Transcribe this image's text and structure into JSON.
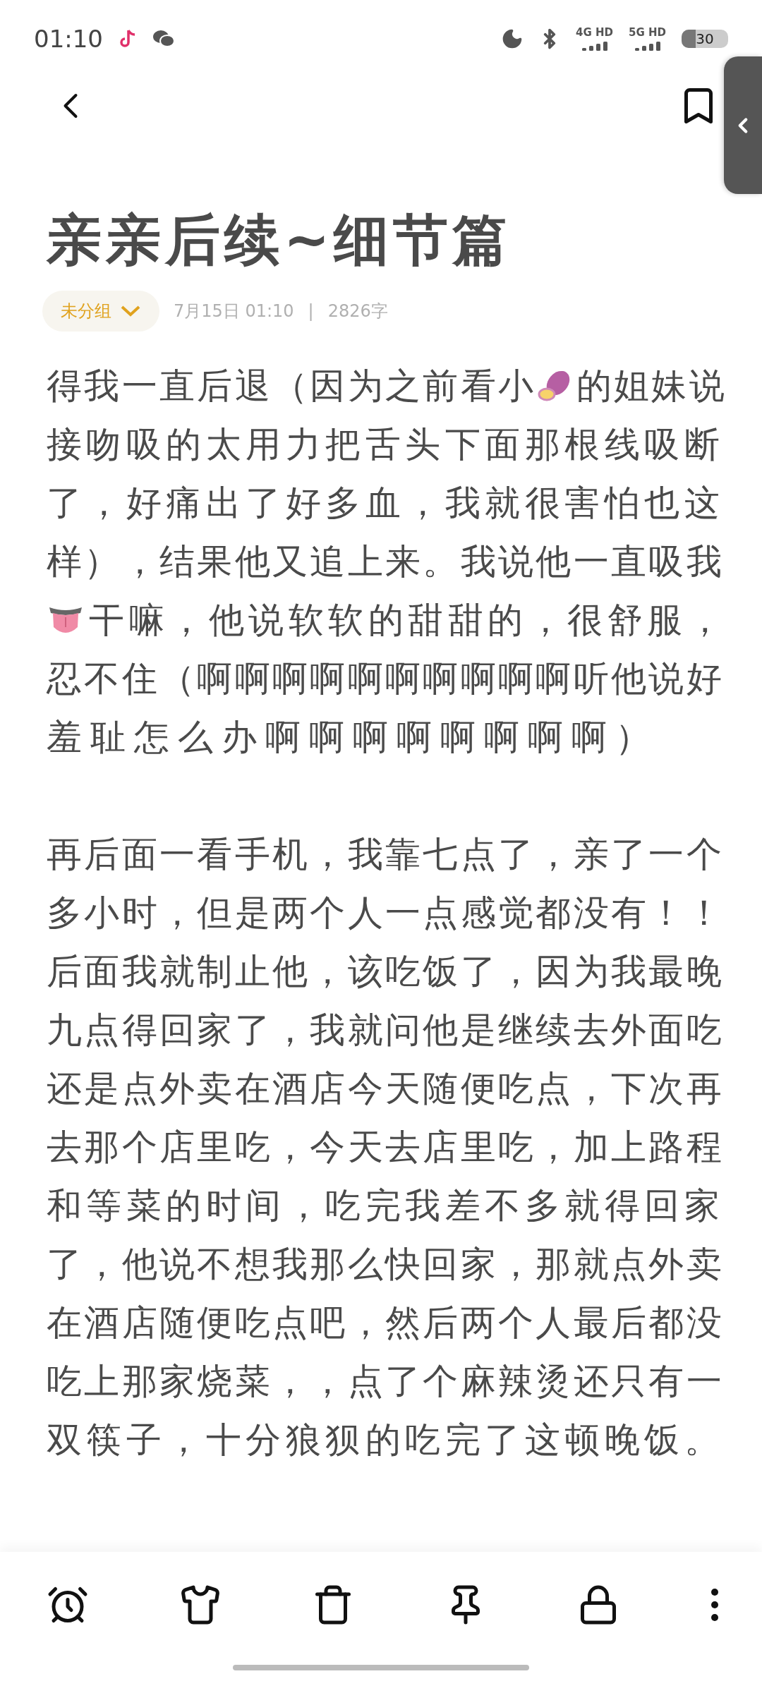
{
  "status_bar": {
    "time": "01:10",
    "network_1": "4G HD",
    "network_2": "5G HD",
    "battery": "30"
  },
  "note": {
    "title": "亲亲后续~细节篇",
    "group": "未分组",
    "date": "7月15日 01:10",
    "separator": "|",
    "word_count": "2826字",
    "paragraphs": [
      {
        "lines": [
          [
            {
              "kind": "text",
              "text": "得我一直后退（因为之前看小"
            },
            {
              "kind": "potato"
            },
            {
              "kind": "text",
              "text": "的姐妹说"
            }
          ],
          [
            {
              "kind": "text",
              "text": "接吻吸的太用力把舌头下面那根线吸断"
            }
          ],
          [
            {
              "kind": "text",
              "text": "了，好痛出了好多血，我就很害怕也这"
            }
          ],
          [
            {
              "kind": "text",
              "text": "样），结果他又追上来。我说他一直吸我"
            }
          ],
          [
            {
              "kind": "tongue"
            },
            {
              "kind": "text",
              "text": "干嘛，他说软软的甜甜的，很舒服，"
            }
          ],
          [
            {
              "kind": "text",
              "text": "忍不住（啊啊啊啊啊啊啊啊啊啊听他说好"
            }
          ],
          [
            {
              "kind": "text",
              "text": "羞耻怎么办啊啊啊啊啊啊啊啊）"
            }
          ]
        ]
      },
      {
        "lines": [
          [
            {
              "kind": "text",
              "text": "再后面一看手机，我靠七点了，亲了一个"
            }
          ],
          [
            {
              "kind": "text",
              "text": "多小时，但是两个人一点感觉都没有！！"
            }
          ],
          [
            {
              "kind": "text",
              "text": "后面我就制止他，该吃饭了，因为我最晚"
            }
          ],
          [
            {
              "kind": "text",
              "text": "九点得回家了，我就问他是继续去外面吃"
            }
          ],
          [
            {
              "kind": "text",
              "text": "还是点外卖在酒店今天随便吃点，下次再"
            }
          ],
          [
            {
              "kind": "text",
              "text": "去那个店里吃，今天去店里吃，加上路程"
            }
          ],
          [
            {
              "kind": "text",
              "text": "和等菜的时间，吃完我差不多就得回家"
            }
          ],
          [
            {
              "kind": "text",
              "text": "了，他说不想我那么快回家，那就点外卖"
            }
          ],
          [
            {
              "kind": "text",
              "text": "在酒店随便吃点吧，然后两个人最后都没"
            }
          ],
          [
            {
              "kind": "text",
              "text": "吃上那家烧菜，，点了个麻辣烫还只有一"
            }
          ],
          [
            {
              "kind": "text",
              "text": "双筷子，十分狼狈的吃完了这顿晚饭。"
            }
          ]
        ]
      }
    ]
  }
}
